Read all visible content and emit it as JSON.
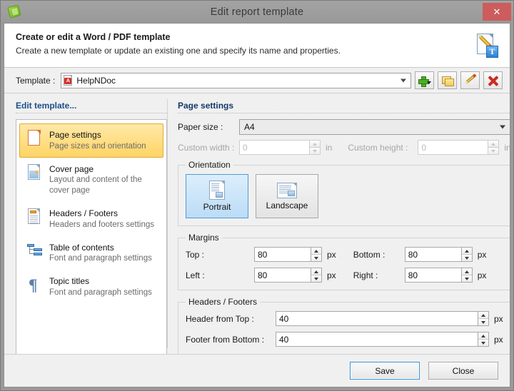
{
  "window": {
    "title": "Edit report template",
    "app_icon": "helpndoc-app-icon",
    "close_label": "✕"
  },
  "banner": {
    "title": "Create or edit a Word / PDF template",
    "subtitle": "Create a new template or update an existing one and specify its name and properties.",
    "icon": "document-edit-text-icon"
  },
  "template_row": {
    "label": "Template :",
    "value": "HelpNDoc",
    "value_icon": "pdf-file-icon",
    "buttons": [
      {
        "name": "add-template-button",
        "icon": "green-plus-icon",
        "has_dropdown": true
      },
      {
        "name": "duplicate-template-button",
        "icon": "folder-copy-icon",
        "has_dropdown": false
      },
      {
        "name": "rename-template-button",
        "icon": "pencil-edit-icon",
        "has_dropdown": false
      },
      {
        "name": "delete-template-button",
        "icon": "red-x-delete-icon",
        "has_dropdown": false
      }
    ]
  },
  "sidebar": {
    "heading": "Edit template...",
    "items": [
      {
        "title": "Page settings",
        "desc": "Page sizes and orientation",
        "icon": "page-icon",
        "selected": true
      },
      {
        "title": "Cover page",
        "desc": "Layout and content of the cover page",
        "icon": "cover-page-icon",
        "selected": false
      },
      {
        "title": "Headers / Footers",
        "desc": "Headers and footers settings",
        "icon": "header-footer-icon",
        "selected": false
      },
      {
        "title": "Table of contents",
        "desc": "Font and paragraph settings",
        "icon": "tree-toc-icon",
        "selected": false
      },
      {
        "title": "Topic titles",
        "desc": "Font and paragraph settings",
        "icon": "pilcrow-icon",
        "selected": false
      }
    ]
  },
  "main": {
    "heading": "Page settings",
    "paper_size": {
      "label": "Paper size :",
      "value": "A4"
    },
    "custom_width": {
      "label": "Custom width :",
      "value": "0",
      "unit": "in",
      "disabled": true
    },
    "custom_height": {
      "label": "Custom height :",
      "value": "0",
      "unit": "in",
      "disabled": true
    },
    "orientation": {
      "legend": "Orientation",
      "options": [
        {
          "label": "Portrait",
          "selected": true
        },
        {
          "label": "Landscape",
          "selected": false
        }
      ]
    },
    "margins": {
      "legend": "Margins",
      "unit": "px",
      "fields": [
        {
          "label": "Top :",
          "value": "80"
        },
        {
          "label": "Bottom :",
          "value": "80"
        },
        {
          "label": "Left :",
          "value": "80"
        },
        {
          "label": "Right :",
          "value": "80"
        }
      ]
    },
    "headers_footers": {
      "legend": "Headers / Footers",
      "unit": "px",
      "fields": [
        {
          "label": "Header from Top :",
          "value": "40"
        },
        {
          "label": "Footer from Bottom :",
          "value": "40"
        }
      ]
    }
  },
  "footer": {
    "save_label": "Save",
    "close_label": "Close"
  },
  "colors": {
    "accent_blue": "#1b4f8a",
    "selection_amber": "#ffd464",
    "close_red": "#cd5c5c",
    "focus_blue": "#3a92d6"
  }
}
